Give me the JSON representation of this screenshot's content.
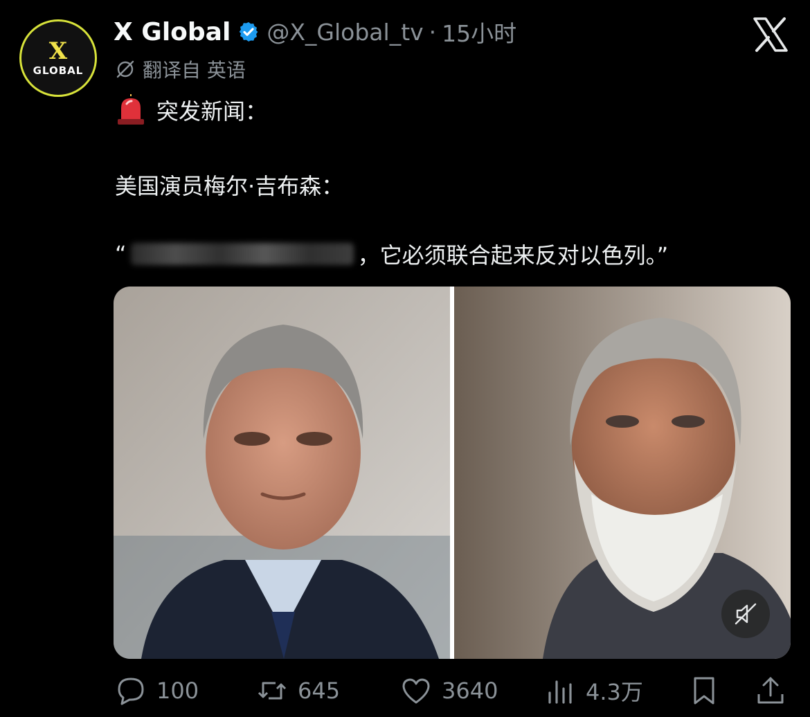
{
  "author": {
    "avatar_text_top": "X",
    "avatar_text_bottom": "GLOBAL",
    "name": "X Global",
    "handle": "@X_Global_tv",
    "separator": "·",
    "time": "15小时"
  },
  "translation_note": "翻译自 英语",
  "body": {
    "line1": "突发新闻：",
    "line2": "美国演员梅尔·吉布森：",
    "line3_open_quote": "“",
    "line3_rest": "，它必须联合起来反对以色列。”"
  },
  "actions": {
    "replies": "100",
    "reposts": "645",
    "likes": "3640",
    "views": "4.3万"
  },
  "icons": {
    "verified": "verified-badge-icon",
    "logo": "x-logo-icon",
    "translate": "translate-icon",
    "siren": "siren-emoji-icon",
    "mute": "muted-speaker-icon",
    "reply": "reply-icon",
    "repost": "repost-icon",
    "like": "heart-icon",
    "views": "views-chart-icon",
    "bookmark": "bookmark-icon",
    "share": "share-icon"
  },
  "colors": {
    "background": "#000000",
    "text": "#e7e9ea",
    "muted": "#8b9298",
    "verified_blue": "#1d9bf0",
    "avatar_yellow": "#d7e23a"
  }
}
